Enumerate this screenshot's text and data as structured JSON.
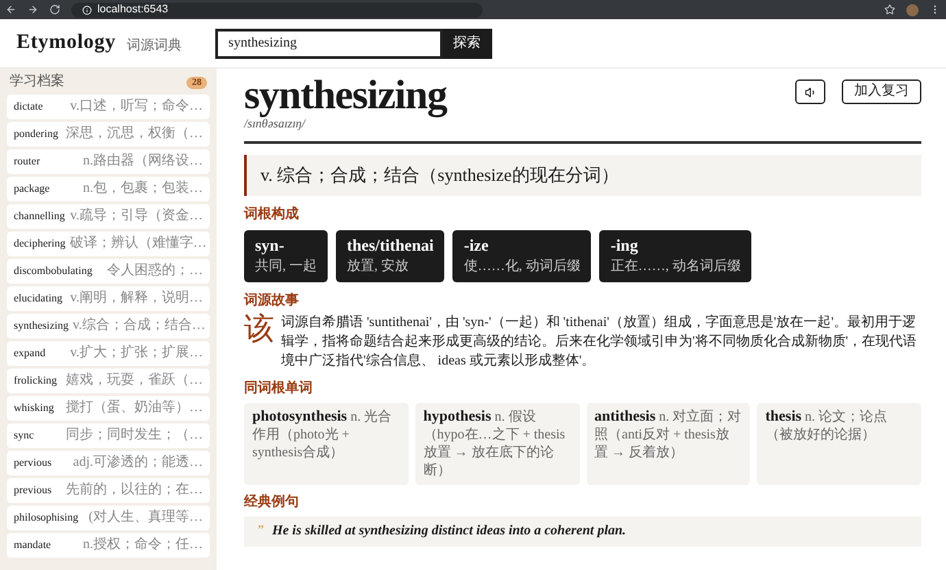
{
  "browser": {
    "url": "localhost:6543"
  },
  "header": {
    "logo": "Etymology",
    "logo_sub": "词源词典",
    "search": {
      "value": "synthesizing"
    },
    "search_button": "探索"
  },
  "sidebar": {
    "title": "学习档案",
    "count": "28",
    "items": [
      {
        "word": "dictate",
        "definition": "v.口述，听写；命令…"
      },
      {
        "word": "pondering",
        "definition": "深思，沉思，权衡（…"
      },
      {
        "word": "router",
        "definition": "n.路由器（网络设…"
      },
      {
        "word": "package",
        "definition": "n.包，包裹；包装…"
      },
      {
        "word": "channelling",
        "definition": "v.疏导；引导（资金…"
      },
      {
        "word": "deciphering",
        "definition": "破译；辨认（难懂字…"
      },
      {
        "word": "discombobulating",
        "definition": "令人困惑的；…"
      },
      {
        "word": "elucidating",
        "definition": "v.阐明，解释，说明…"
      },
      {
        "word": "synthesizing",
        "definition": "v.综合；合成；结合…"
      },
      {
        "word": "expand",
        "definition": "v.扩大；扩张；扩展…"
      },
      {
        "word": "frolicking",
        "definition": "嬉戏，玩耍，雀跃（…"
      },
      {
        "word": "whisking",
        "definition": "搅打（蛋、奶油等）…"
      },
      {
        "word": "sync",
        "definition": "同步；同时发生；（…"
      },
      {
        "word": "pervious",
        "definition": "adj.可渗透的；能透…"
      },
      {
        "word": "previous",
        "definition": "先前的，以往的；在…"
      },
      {
        "word": "philosophising",
        "definition": "(对人生、真理等…"
      },
      {
        "word": "mandate",
        "definition": "n.授权；命令；任…"
      }
    ]
  },
  "entry": {
    "word": "synthesizing",
    "phonetic": "/sɪnθəsaɪzɪŋ/",
    "review_button": "加入复习",
    "definition": "v. 综合；合成；结合（synthesize的现在分词）",
    "roots_label": "词根构成",
    "roots": [
      {
        "part": "syn-",
        "meaning": "共同, 一起"
      },
      {
        "part": "thes/tithenai",
        "meaning": "放置, 安放"
      },
      {
        "part": "-ize",
        "meaning": "使……化, 动词后缀"
      },
      {
        "part": "-ing",
        "meaning": "正在……, 动名词后缀"
      }
    ],
    "story_label": "词源故事",
    "story_initial": "该",
    "story": "词源自希腊语 'suntithenai'，由 'syn-'（一起）和 'tithenai'（放置）组成，字面意思是'放在一起'。最初用于逻辑学，指将命题结合起来形成更高级的结论。后来在化学领域引申为'将不同物质化合成新物质'，在现代语境中广泛指代'综合信息、 ideas 或元素以形成整体'。",
    "related_label": "同词根单词",
    "related": [
      {
        "word": "photosynthesis",
        "note": "n. 光合作用（photo光 + synthesis合成）"
      },
      {
        "word": "hypothesis",
        "note": "n. 假设（hypo在…之下 + thesis放置 → 放在底下的论断）"
      },
      {
        "word": "antithesis",
        "note": "n. 对立面；对照（anti反对 + thesis放置 → 反着放）"
      },
      {
        "word": "thesis",
        "note": "n. 论文；论点（被放好的论据）"
      }
    ],
    "example_label": "经典例句",
    "example_mark": "”",
    "example": "He is skilled at synthesizing distinct ideas into a coherent plan."
  }
}
